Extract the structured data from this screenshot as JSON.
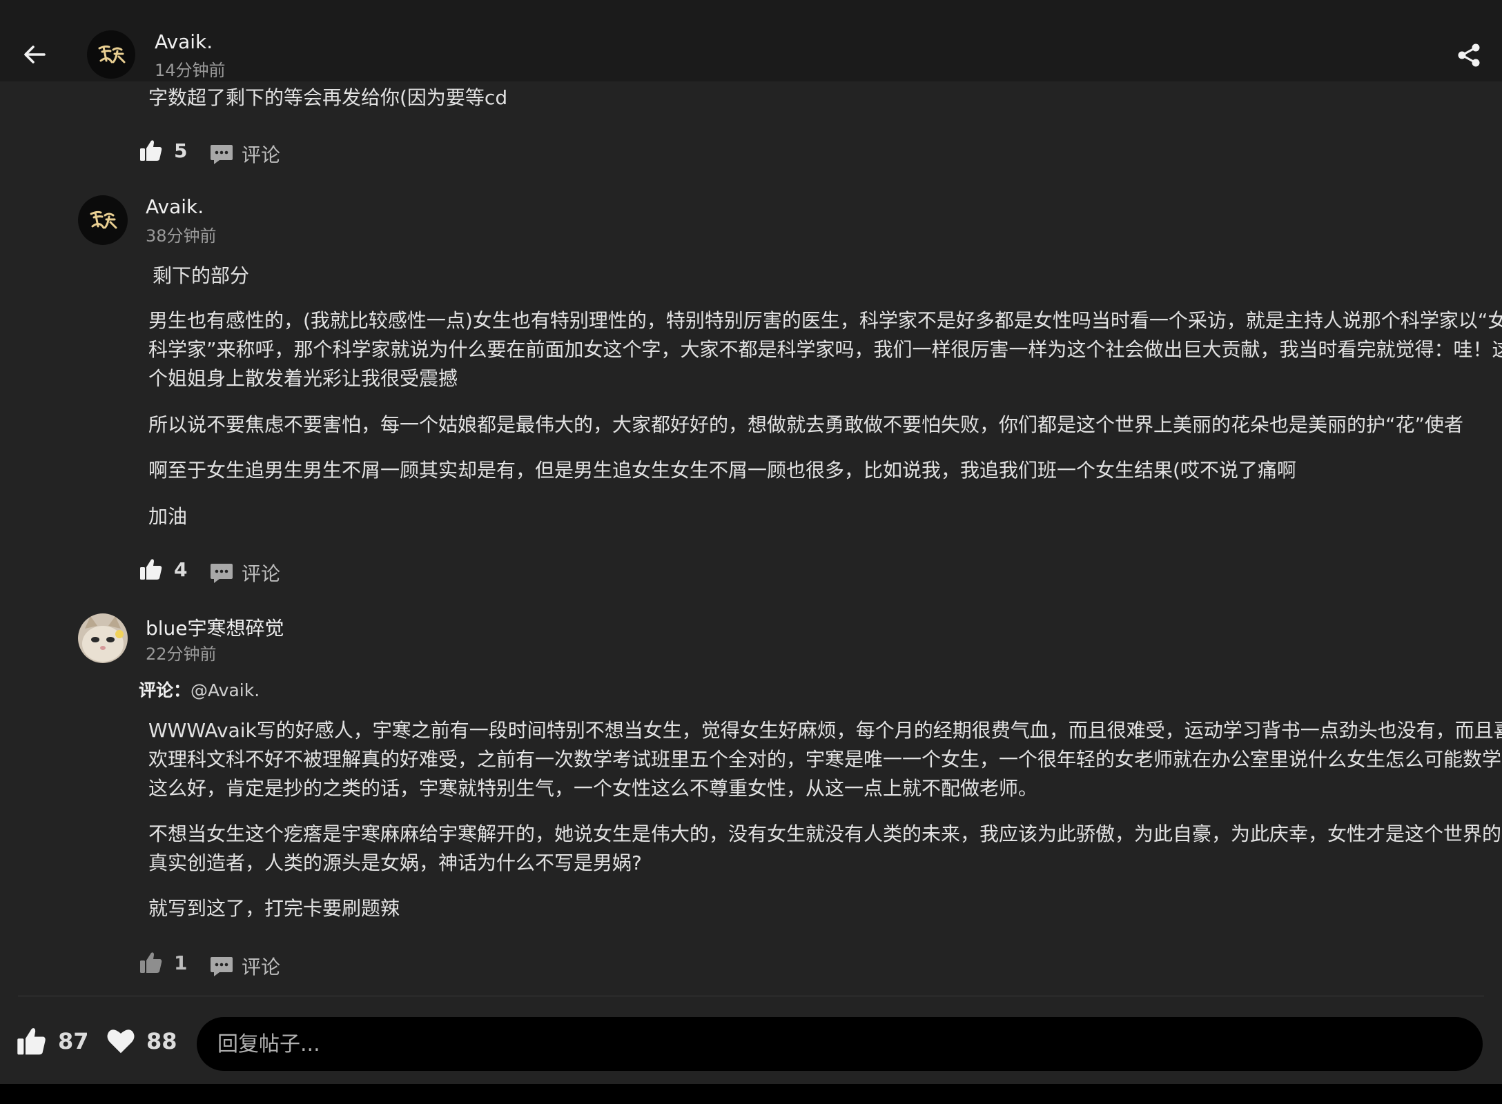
{
  "header": {
    "name": "Avaik.",
    "time": "14分钟前"
  },
  "first_comment": {
    "text": "字数超了剩下的等会再发给你(因为要等cd",
    "likes": "5",
    "comment_label": "评论"
  },
  "second_comment": {
    "username": "Avaik.",
    "time": "38分钟前",
    "intro": "剩下的部分",
    "paragraphs": [
      "男生也有感性的，(我就比较感性一点)女生也有特别理性的，特别特别厉害的医生，科学家不是好多都是女性吗当时看一个采访，就是主持人说那个科学家以“女科学家”来称呼，那个科学家就说为什么要在前面加女这个字，大家不都是科学家吗，我们一样很厉害一样为这个社会做出巨大贡献，我当时看完就觉得：哇！这个姐姐身上散发着光彩让我很受震撼",
      "所以说不要焦虑不要害怕，每一个姑娘都是最伟大的，大家都好好的，想做就去勇敢做不要怕失败，你们都是这个世界上美丽的花朵也是美丽的护“花”使者",
      "啊至于女生追男生男生不屑一顾其实却是有，但是男生追女生女生不屑一顾也很多，比如说我，我追我们班一个女生结果(哎不说了痛啊",
      "加油"
    ],
    "likes": "4",
    "comment_label": "评论"
  },
  "third_comment": {
    "username": "blue宇寒想碎觉",
    "time": "22分钟前",
    "reply_prefix": "评论：",
    "reply_mention": "@Avaik.",
    "paragraphs": [
      "WWWAvaik写的好感人，宇寒之前有一段时间特别不想当女生，觉得女生好麻烦，每个月的经期很费气血，而且很难受，运动学习背书一点劲头也没有，而且喜欢理科文科不好不被理解真的好难受，之前有一次数学考试班里五个全对的，宇寒是唯一一个女生，一个很年轻的女老师就在办公室里说什么女生怎么可能数学这么好，肯定是抄的之类的话，宇寒就特别生气，一个女性这么不尊重女性，从这一点上就不配做老师。",
      "不想当女生这个疙瘩是宇寒麻麻给宇寒解开的，她说女生是伟大的，没有女生就没有人类的未来，我应该为此骄傲，为此自豪，为此庆幸，女性才是这个世界的真实创造者，人类的源头是女娲，神话为什么不写是男娲?",
      "就写到这了，打完卡要刷题辣"
    ],
    "likes": "1",
    "comment_label": "评论"
  },
  "bottom_bar": {
    "like_count": "87",
    "favorite_count": "88",
    "reply_placeholder": "回复帖子..."
  },
  "colors": {
    "background": "#232323",
    "header": "#1b1b1b",
    "input_background": "#000000"
  },
  "icons": [
    "back-arrow-icon",
    "share-icon",
    "thumbs-up-icon",
    "comment-bubble-icon",
    "heart-icon"
  ]
}
